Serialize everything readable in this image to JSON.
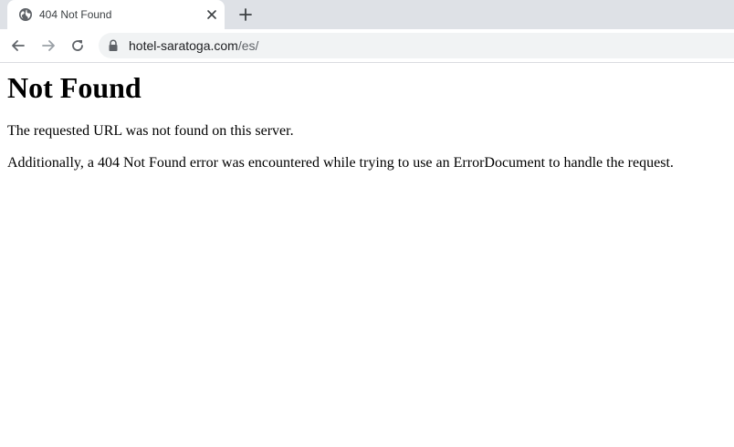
{
  "browser": {
    "tab": {
      "title": "404 Not Found",
      "favicon": "globe-icon"
    },
    "toolbar": {
      "back_icon": "arrow-left-icon",
      "forward_icon": "arrow-right-icon",
      "reload_icon": "reload-icon",
      "security_icon": "lock-icon"
    },
    "address": {
      "host": "hotel-saratoga.com",
      "path": "/es/"
    }
  },
  "page": {
    "heading": "Not Found",
    "message": "The requested URL was not found on this server.",
    "detail": "Additionally, a 404 Not Found error was encountered while trying to use an ErrorDocument to handle the request."
  },
  "colors": {
    "tabstrip": "#dee1e6",
    "omnibox": "#f1f3f4",
    "icon": "#5f6368",
    "icon_disabled": "#9aa0a6"
  }
}
